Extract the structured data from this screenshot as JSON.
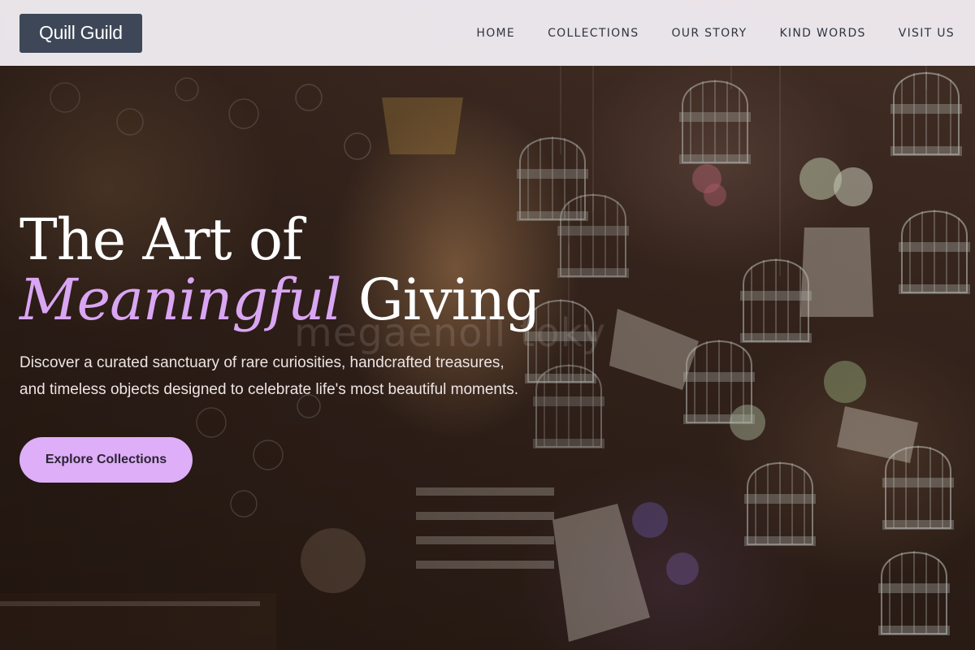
{
  "brand": {
    "name": "Quill Guild"
  },
  "nav": {
    "items": [
      {
        "label": "HOME"
      },
      {
        "label": "COLLECTIONS"
      },
      {
        "label": "OUR STORY"
      },
      {
        "label": "KIND WORDS"
      },
      {
        "label": "VISIT US"
      }
    ]
  },
  "hero": {
    "title_line1": "The Art of",
    "title_accent": "Meaningful",
    "title_line2_rest": " Giving",
    "subtitle": "Discover a curated sanctuary of rare curiosities, handcrafted treasures, and timeless objects designed to celebrate life's most beautiful moments.",
    "cta_label": "Explore Collections",
    "watermark": "megaenoll toky"
  },
  "colors": {
    "header_bg": "#f4f0f5",
    "logo_bg": "#3d4757",
    "accent": "#d9a6f3",
    "cta_bg": "#deaef8",
    "nav_text": "#2e3440"
  }
}
